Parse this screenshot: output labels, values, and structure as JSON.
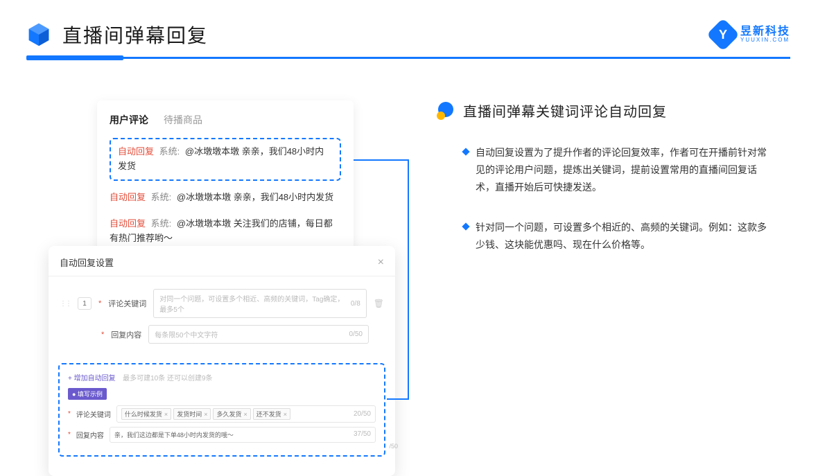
{
  "header": {
    "title": "直播间弹幕回复",
    "brand_cn": "昱新科技",
    "brand_en": "YUUXIN.COM"
  },
  "comments_card": {
    "tab_active": "用户评论",
    "tab_inactive": "待播商品",
    "tag_reply": "自动回复",
    "tag_system": "系统:",
    "row1": "@冰墩墩本墩 亲亲，我们48小时内发货",
    "row2": "@冰墩墩本墩 亲亲，我们48小时内发货",
    "row3": "@冰墩墩本墩 关注我们的店铺，每日都有热门推荐哟～"
  },
  "settings_card": {
    "title": "自动回复设置",
    "num": "1",
    "label_keyword": "评论关键词",
    "placeholder_keyword": "对同一个问题，可设置多个相近、高频的关键词，Tag确定，最多5个",
    "counter_keyword": "0/8",
    "label_content": "回复内容",
    "placeholder_content": "每条限50个中文字符",
    "counter_content": "0/50",
    "add_link": "+ 增加自动回复",
    "add_hint": "最多可建10条 还可以创建9条",
    "example_badge": "● 填写示例",
    "ex_label_keyword": "评论关键词",
    "ex_tags": [
      "什么时候发货",
      "发货时间",
      "多久发货",
      "还不发货"
    ],
    "ex_counter_kw": "20/50",
    "ex_label_content": "回复内容",
    "ex_content_text": "亲，我们这边都是下单48小时内发货的哦～",
    "ex_counter_ct": "37/50",
    "outer_counter": "/50"
  },
  "right": {
    "section_title": "直播间弹幕关键词评论自动回复",
    "bullet1": "自动回复设置为了提升作者的评论回复效率，作者可在开播前针对常见的评论用户问题，提炼出关键词，提前设置常用的直播间回复话术，直播开始后可快捷发送。",
    "bullet2": "针对同一个问题，可设置多个相近的、高频的关键词。例如：这款多少钱、这块能优惠吗、现在什么价格等。"
  }
}
